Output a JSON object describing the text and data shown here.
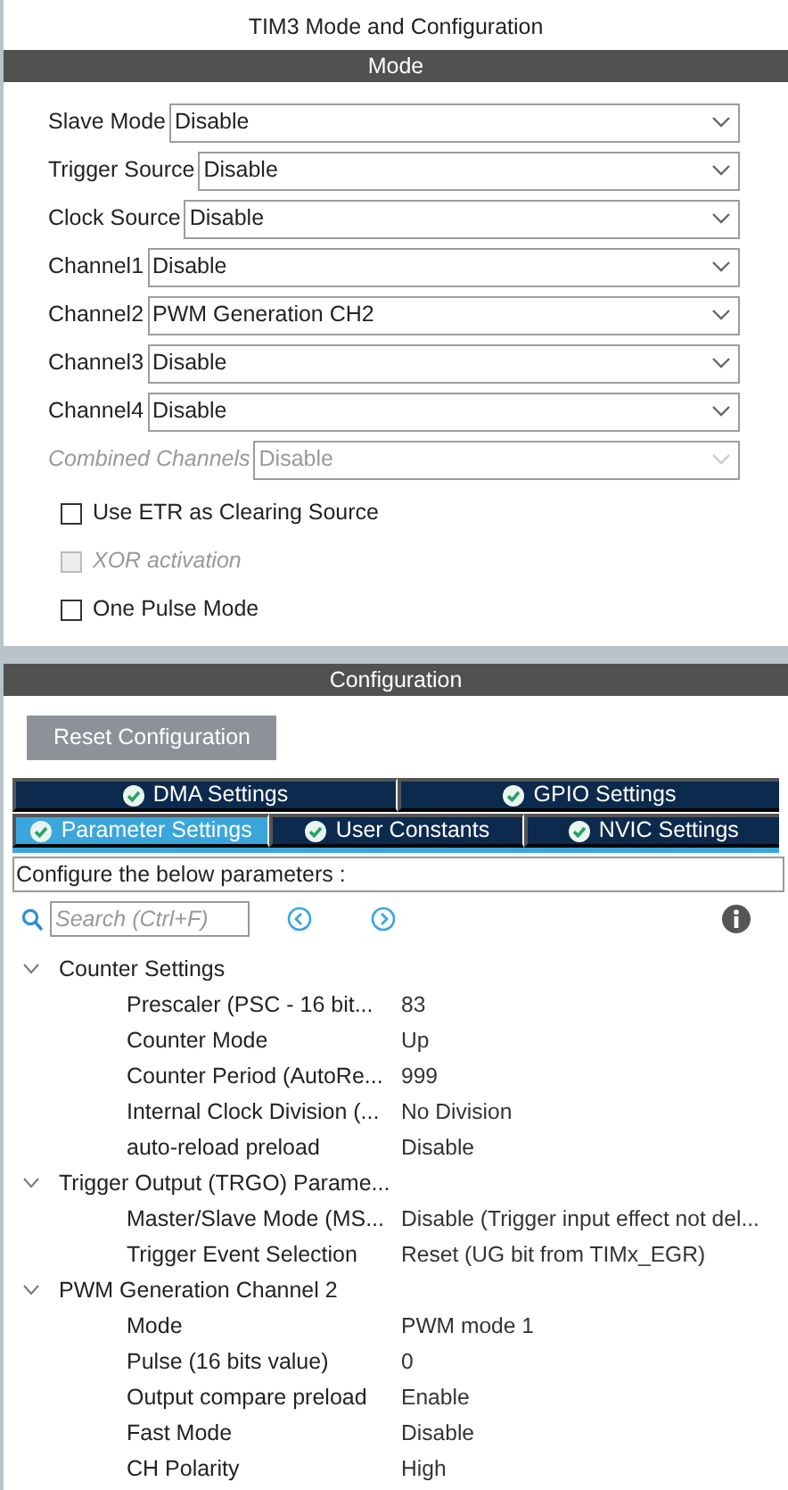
{
  "window": {
    "title": "TIM3 Mode and Configuration"
  },
  "mode": {
    "header": "Mode",
    "fields": [
      {
        "label": "Slave Mode",
        "value": "Disable",
        "disabled": false
      },
      {
        "label": "Trigger Source",
        "value": "Disable",
        "disabled": false
      },
      {
        "label": "Clock Source",
        "value": "Disable",
        "disabled": false
      },
      {
        "label": "Channel1",
        "value": "Disable",
        "disabled": false
      },
      {
        "label": "Channel2",
        "value": "PWM Generation CH2",
        "disabled": false
      },
      {
        "label": "Channel3",
        "value": "Disable",
        "disabled": false
      },
      {
        "label": "Channel4",
        "value": "Disable",
        "disabled": false
      },
      {
        "label": "Combined Channels",
        "value": "Disable",
        "disabled": true
      }
    ],
    "checkboxes": [
      {
        "label": "Use ETR as Clearing Source",
        "checked": false,
        "disabled": false
      },
      {
        "label": "XOR activation",
        "checked": false,
        "disabled": true
      },
      {
        "label": "One Pulse Mode",
        "checked": false,
        "disabled": false
      }
    ]
  },
  "configuration": {
    "header": "Configuration",
    "reset_button": "Reset Configuration",
    "tab_rows": [
      [
        {
          "label": "DMA Settings",
          "selected": false
        },
        {
          "label": "GPIO Settings",
          "selected": false
        }
      ],
      [
        {
          "label": "Parameter Settings",
          "selected": true
        },
        {
          "label": "User Constants",
          "selected": false
        },
        {
          "label": "NVIC Settings",
          "selected": false
        }
      ]
    ],
    "description": "Configure the below parameters :",
    "search": {
      "placeholder": "Search (Ctrl+F)"
    },
    "tree": [
      {
        "label": "Counter Settings",
        "expanded": true,
        "children": [
          {
            "name": "Prescaler (PSC - 16 bit...",
            "value": "83"
          },
          {
            "name": "Counter Mode",
            "value": "Up"
          },
          {
            "name": "Counter Period (AutoRe...",
            "value": "999"
          },
          {
            "name": "Internal Clock Division (...",
            "value": "No Division"
          },
          {
            "name": "auto-reload preload",
            "value": "Disable"
          }
        ]
      },
      {
        "label": "Trigger Output (TRGO) Parame...",
        "expanded": true,
        "children": [
          {
            "name": "Master/Slave Mode (MS...",
            "value": "Disable (Trigger input effect not del..."
          },
          {
            "name": "Trigger Event Selection",
            "value": "Reset (UG bit from TIMx_EGR)"
          }
        ]
      },
      {
        "label": "PWM Generation Channel 2",
        "expanded": true,
        "children": [
          {
            "name": "Mode",
            "value": "PWM mode 1"
          },
          {
            "name": "Pulse (16 bits value)",
            "value": "0"
          },
          {
            "name": "Output compare preload",
            "value": "Enable"
          },
          {
            "name": "Fast Mode",
            "value": "Disable"
          },
          {
            "name": "CH Polarity",
            "value": "High"
          }
        ]
      }
    ]
  }
}
